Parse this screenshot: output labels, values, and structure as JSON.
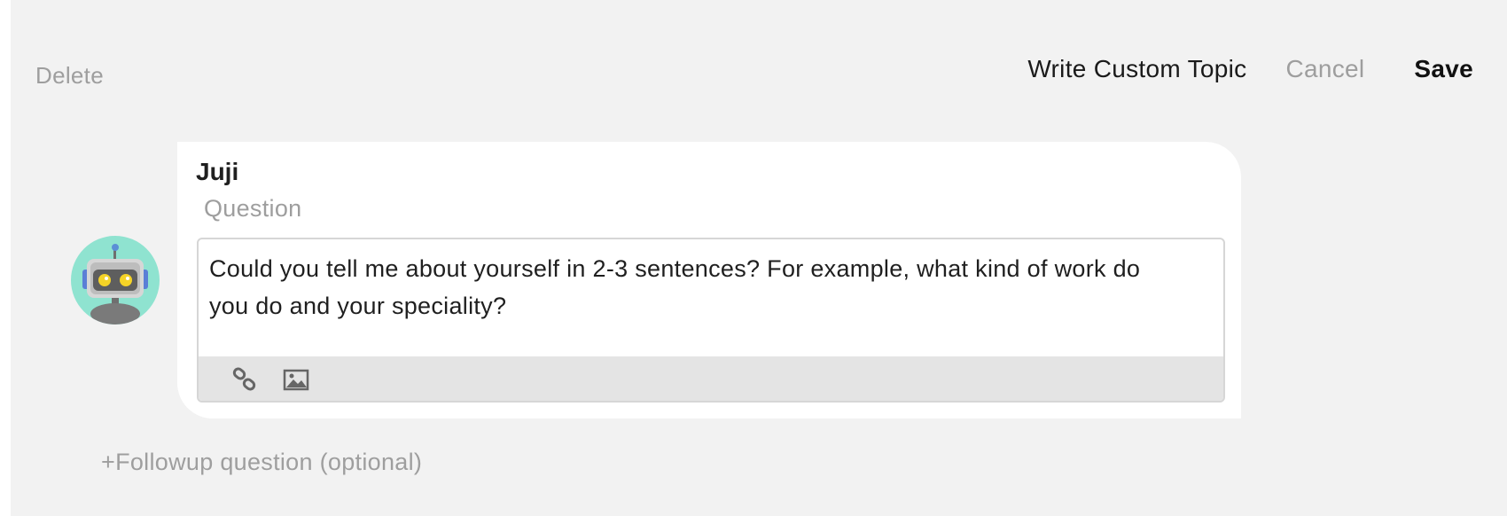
{
  "header": {
    "delete_label": "Delete",
    "custom_topic_label": "Write Custom Topic",
    "cancel_label": "Cancel",
    "save_label": "Save"
  },
  "message": {
    "bot_name": "Juji",
    "field_label": "Question",
    "question_text": "Could you tell me about yourself in 2-3 sentences? For example, what kind of work do you do and your speciality?",
    "toolbar_icons": [
      "link-icon",
      "image-icon"
    ]
  },
  "followup_label": "+Followup question (optional)",
  "colors": {
    "panel_background": "#f2f2f2",
    "bubble_background": "#ffffff",
    "muted_text": "#9e9e9e",
    "avatar_background": "#8fe3d0",
    "robot_eye": "#f5d327"
  }
}
